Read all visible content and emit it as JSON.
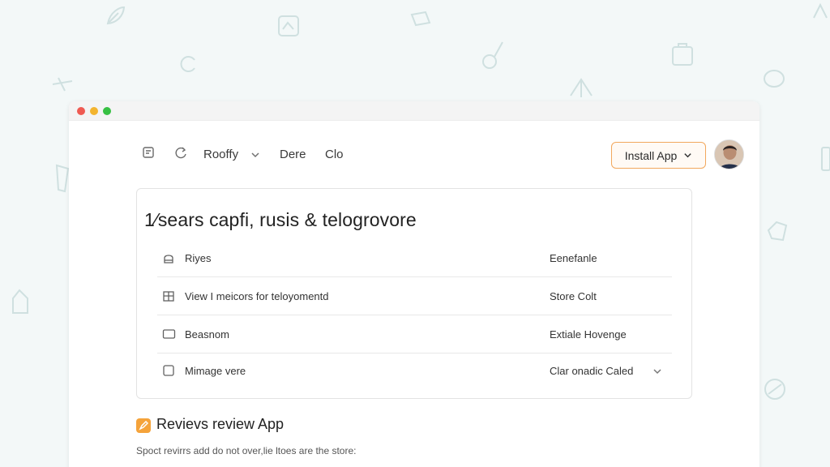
{
  "window": {
    "controls": [
      "close",
      "minimize",
      "maximize"
    ]
  },
  "topnav": {
    "items": [
      {
        "label": "Rooffy"
      },
      {
        "label": "Dere"
      },
      {
        "label": "Clo"
      }
    ],
    "install_label": "Install App"
  },
  "card": {
    "title": "1⁄sears capfi, rusis & telogrovore",
    "rows": [
      {
        "label": "Riyes",
        "value": "Eenefanle",
        "icon": "lock-icon"
      },
      {
        "label": "View I meicors for teloyomentd",
        "value": "Store Colt",
        "icon": "building-icon"
      },
      {
        "label": "Beasnom",
        "value": "Extiale Hovenge",
        "icon": "rectangle-icon"
      },
      {
        "label": "Mimage vere",
        "value": "Clar onadic Caled",
        "icon": "checkbox-icon"
      }
    ]
  },
  "section": {
    "title": "Revievs review App",
    "text": "Spoct revirrs add do not over,lie ltoes are the store:"
  },
  "colors": {
    "accent": "#f2a85d",
    "section_icon": "#f5a33a",
    "background": "#f3f8f8"
  }
}
